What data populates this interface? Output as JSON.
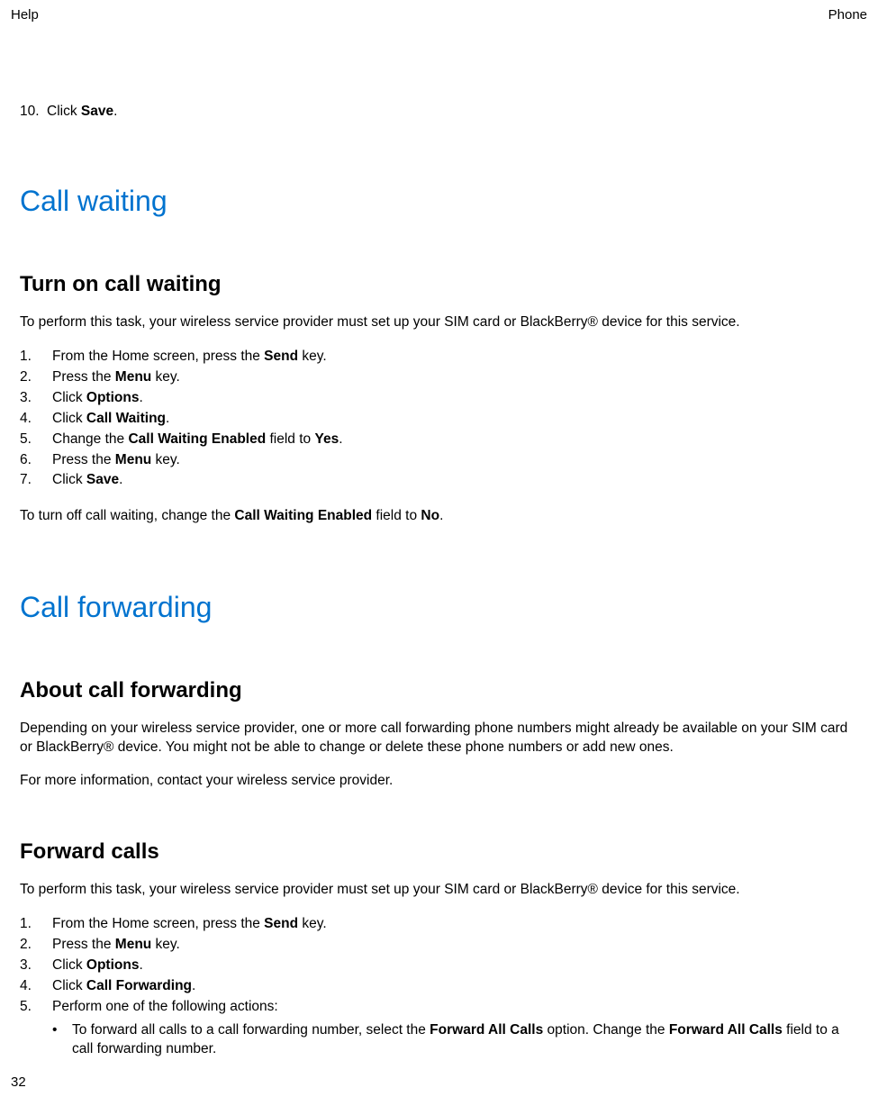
{
  "header": {
    "left": "Help",
    "right": "Phone"
  },
  "step10": {
    "num": "10.",
    "pre": "Click ",
    "bold": "Save",
    "post": "."
  },
  "h1_cw": "Call waiting",
  "h2_turn_on": "Turn on call waiting",
  "cw_intro": "To perform this task, your wireless service provider must set up your SIM card or BlackBerry® device for this service.",
  "cw_steps": [
    {
      "num": "1.",
      "pre": "From the Home screen, press the ",
      "bold": "Send",
      "post": " key."
    },
    {
      "num": "2.",
      "pre": "Press the ",
      "bold": "Menu",
      "post": " key."
    },
    {
      "num": "3.",
      "pre": "Click ",
      "bold": "Options",
      "post": "."
    },
    {
      "num": "4.",
      "pre": "Click ",
      "bold": "Call Waiting",
      "post": "."
    },
    {
      "num": "5.",
      "pre": "Change the ",
      "bold": "Call Waiting Enabled",
      "mid": " field to ",
      "bold2": "Yes",
      "post": "."
    },
    {
      "num": "6.",
      "pre": "Press the ",
      "bold": "Menu",
      "post": " key."
    },
    {
      "num": "7.",
      "pre": "Click ",
      "bold": "Save",
      "post": "."
    }
  ],
  "cw_outro_pre": "To turn off call waiting, change the ",
  "cw_outro_bold": "Call Waiting Enabled",
  "cw_outro_mid": " field to ",
  "cw_outro_bold2": "No",
  "cw_outro_post": ".",
  "h1_cf": "Call forwarding",
  "h2_about": "About call forwarding",
  "cf_about_p1": "Depending on your wireless service provider, one or more call forwarding phone numbers might already be available on your SIM card or BlackBerry® device. You might not be able to change or delete these phone numbers or add new ones.",
  "cf_about_p2": "For more information, contact your wireless service provider.",
  "h2_forward": "Forward calls",
  "cf_intro": "To perform this task, your wireless service provider must set up your SIM card or BlackBerry® device for this service.",
  "cf_steps": [
    {
      "num": "1.",
      "pre": "From the Home screen, press the ",
      "bold": "Send",
      "post": " key."
    },
    {
      "num": "2.",
      "pre": "Press the ",
      "bold": "Menu",
      "post": " key."
    },
    {
      "num": "3.",
      "pre": "Click ",
      "bold": "Options",
      "post": "."
    },
    {
      "num": "4.",
      "pre": "Click ",
      "bold": "Call Forwarding",
      "post": "."
    },
    {
      "num": "5.",
      "pre": "Perform one of the following actions:",
      "bold": "",
      "post": ""
    }
  ],
  "cf_bullet": {
    "dot": "•",
    "pre": "To forward all calls to a call forwarding number, select the ",
    "bold": "Forward All Calls",
    "mid": " option. Change the ",
    "bold2": "Forward All Calls",
    "post": " field to a call forwarding number."
  },
  "page_num": "32"
}
